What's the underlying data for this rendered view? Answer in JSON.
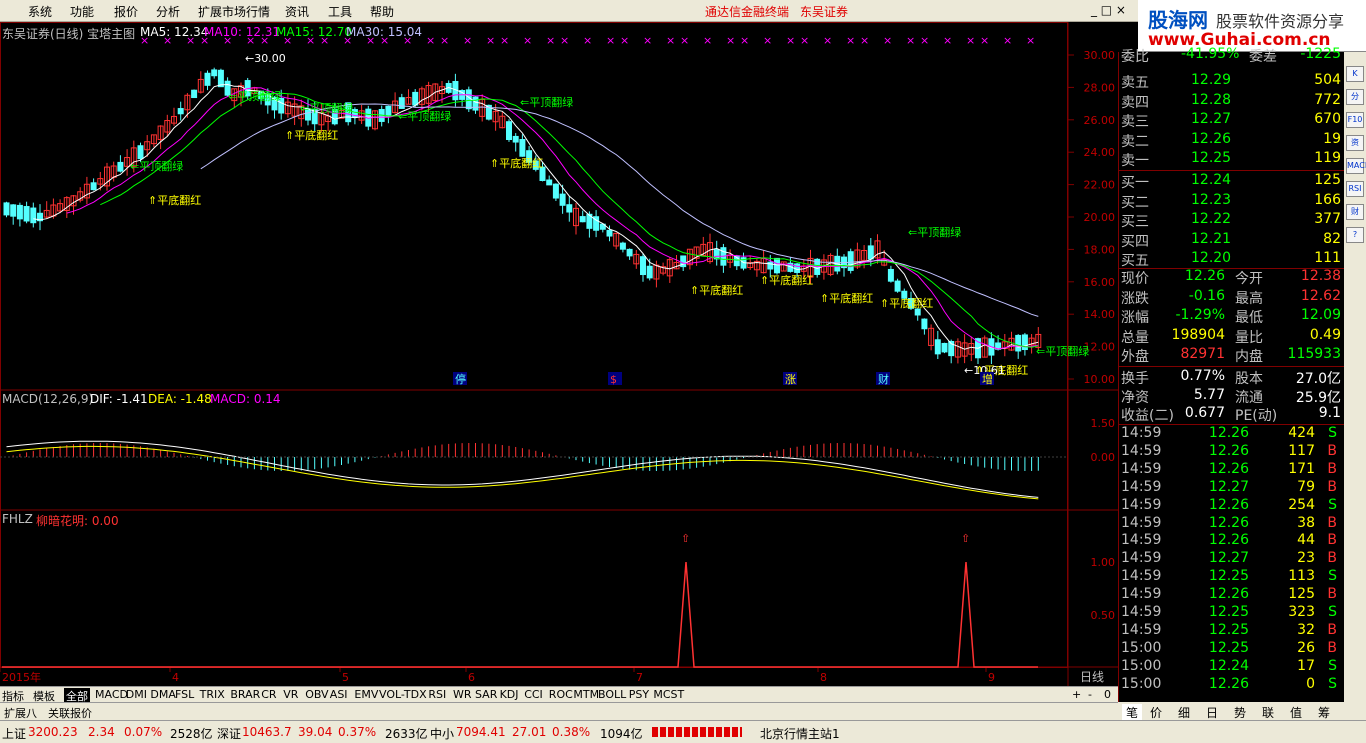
{
  "menu": {
    "items": [
      "系统",
      "功能",
      "报价",
      "分析",
      "扩展市场行情",
      "资讯",
      "工具",
      "帮助"
    ],
    "brand1": "通达信金融终端",
    "brand2": "东吴证券"
  },
  "logo": {
    "line1": "股海网",
    "line1b": "股票软件资源分享",
    "line2": "www.Guhai.com.cn"
  },
  "chart_header": {
    "stock": "东吴证券(日线) 宝塔主图",
    "ma5": "MA5: 12.34",
    "ma10": "MA10: 12.31",
    "ma15": "MA15: 12.70",
    "ma30": "MA30: 15.04"
  },
  "price_axis": [
    "30.00",
    "28.00",
    "26.00",
    "24.00",
    "22.00",
    "20.00",
    "18.00",
    "16.00",
    "14.00",
    "12.00",
    "10.00"
  ],
  "macd_header": {
    "name": "MACD(12,26,9)",
    "dif": "DIF: -1.41",
    "dea": "DEA: -1.48",
    "macd": "MACD: 0.14"
  },
  "macd_axis": [
    "1.50",
    "0.00"
  ],
  "fhlz_header": {
    "name": "FHLZ",
    "label": "柳暗花明: 0.00"
  },
  "fhlz_axis": [
    "1.00",
    "0.50"
  ],
  "annotations": {
    "high": "30.00",
    "low": "10.61",
    "top_green": "平顶翻绿",
    "bottom_red": "平底翻红",
    "markers": [
      "停",
      "$",
      "涨",
      "财",
      "增"
    ]
  },
  "date_axis": [
    "2015年",
    "4",
    "5",
    "6",
    "7",
    "8",
    "9"
  ],
  "period_label": "日线",
  "tabs": [
    "指标",
    "模板",
    "全部",
    "MACD",
    "DMI",
    "DMA",
    "FSL",
    "TRIX",
    "BRAR",
    "CR",
    "VR",
    "OBV",
    "ASI",
    "EMV",
    "VOL-TDX",
    "RSI",
    "WR",
    "SAR",
    "KDJ",
    "CCI",
    "ROC",
    "MTM",
    "BOLL",
    "PSY",
    "MCST"
  ],
  "tab_controls": [
    "+",
    "-",
    "0"
  ],
  "subbar": [
    "扩展八",
    "关联报价"
  ],
  "quote": {
    "top_partial": {
      "label": "委比",
      "value": "-41.95%",
      "label2": "委差",
      "value2": "-1225"
    },
    "sells": [
      {
        "label": "卖五",
        "price": "12.29",
        "vol": "504"
      },
      {
        "label": "卖四",
        "price": "12.28",
        "vol": "772"
      },
      {
        "label": "卖三",
        "price": "12.27",
        "vol": "670"
      },
      {
        "label": "卖二",
        "price": "12.26",
        "vol": "19"
      },
      {
        "label": "卖一",
        "price": "12.25",
        "vol": "119"
      }
    ],
    "buys": [
      {
        "label": "买一",
        "price": "12.24",
        "vol": "125"
      },
      {
        "label": "买二",
        "price": "12.23",
        "vol": "166"
      },
      {
        "label": "买三",
        "price": "12.22",
        "vol": "377"
      },
      {
        "label": "买四",
        "price": "12.21",
        "vol": "82"
      },
      {
        "label": "买五",
        "price": "12.20",
        "vol": "111"
      }
    ],
    "stats": [
      {
        "l1": "现价",
        "v1": "12.26",
        "l2": "今开",
        "v2": "12.38"
      },
      {
        "l1": "涨跌",
        "v1": "-0.16",
        "l2": "最高",
        "v2": "12.62"
      },
      {
        "l1": "涨幅",
        "v1": "-1.29%",
        "l2": "最低",
        "v2": "12.09"
      },
      {
        "l1": "总量",
        "v1": "198904",
        "l2": "量比",
        "v2": "0.49"
      },
      {
        "l1": "外盘",
        "v1": "82971",
        "l2": "内盘",
        "v2": "115933"
      }
    ],
    "stats2": [
      {
        "l1": "换手",
        "v1": "0.77%",
        "l2": "股本",
        "v2": "27.0亿"
      },
      {
        "l1": "净资",
        "v1": "5.77",
        "l2": "流通",
        "v2": "25.9亿"
      },
      {
        "l1": "收益(二)",
        "v1": "0.677",
        "l2": "PE(动)",
        "v2": "9.1"
      }
    ],
    "ticks": [
      {
        "t": "14:59",
        "p": "12.26",
        "v": "424",
        "s": "S"
      },
      {
        "t": "14:59",
        "p": "12.26",
        "v": "117",
        "s": "B"
      },
      {
        "t": "14:59",
        "p": "12.26",
        "v": "171",
        "s": "B"
      },
      {
        "t": "14:59",
        "p": "12.27",
        "v": "79",
        "s": "B"
      },
      {
        "t": "14:59",
        "p": "12.26",
        "v": "254",
        "s": "S"
      },
      {
        "t": "14:59",
        "p": "12.26",
        "v": "38",
        "s": "B"
      },
      {
        "t": "14:59",
        "p": "12.26",
        "v": "44",
        "s": "B"
      },
      {
        "t": "14:59",
        "p": "12.27",
        "v": "23",
        "s": "B"
      },
      {
        "t": "14:59",
        "p": "12.25",
        "v": "113",
        "s": "S"
      },
      {
        "t": "14:59",
        "p": "12.26",
        "v": "125",
        "s": "B"
      },
      {
        "t": "14:59",
        "p": "12.25",
        "v": "323",
        "s": "S"
      },
      {
        "t": "14:59",
        "p": "12.25",
        "v": "32",
        "s": "B"
      },
      {
        "t": "15:00",
        "p": "12.25",
        "v": "26",
        "s": "B"
      },
      {
        "t": "15:00",
        "p": "12.24",
        "v": "17",
        "s": "S"
      },
      {
        "t": "15:00",
        "p": "12.26",
        "v": "0",
        "s": "S"
      }
    ]
  },
  "quote_tabs": [
    "笔",
    "价",
    "细",
    "日",
    "势",
    "联",
    "值",
    "筹"
  ],
  "sidebar_icons": [
    "K",
    "分",
    "F10",
    "资",
    "MACD",
    "RSI",
    "财",
    "?"
  ],
  "status": {
    "sh_label": "上证",
    "sh_val": "3200.23",
    "sh_chg": "2.34",
    "sh_pct": "0.07%",
    "sh_amt": "2528亿",
    "sz_label": "深证",
    "sz_val": "10463.7",
    "sz_chg": "39.04",
    "sz_pct": "0.37%",
    "sz_amt": "2633亿",
    "zx_label": "中小",
    "zx_val": "7094.41",
    "zx_chg": "27.01",
    "zx_pct": "0.38%",
    "zx_amt": "1094亿",
    "server": "北京行情主站1"
  },
  "colors": {
    "up": "#ff3232",
    "down": "#54ffff",
    "ma5": "#ffffff",
    "ma10": "#ff00ff",
    "ma15": "#00ff00",
    "ma30": "#c0c0ff",
    "axis": "#800000"
  }
}
